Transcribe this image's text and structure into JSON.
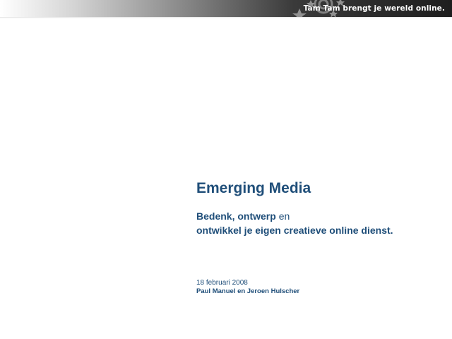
{
  "header": {
    "tagline": "Tam Tam brengt je wereld online."
  },
  "slide": {
    "title": "Emerging Media",
    "subtitle_line1_bold": "Bedenk, ontwerp",
    "subtitle_line1_regular": "en",
    "subtitle_line2": "ontwikkel je eigen creatieve online dienst.",
    "date": "18 februari 2008",
    "authors": "Paul Manuel en Jeroen Hulscher"
  },
  "colors": {
    "text": "#1f4e79",
    "header_dark": "#1e1e1e"
  }
}
